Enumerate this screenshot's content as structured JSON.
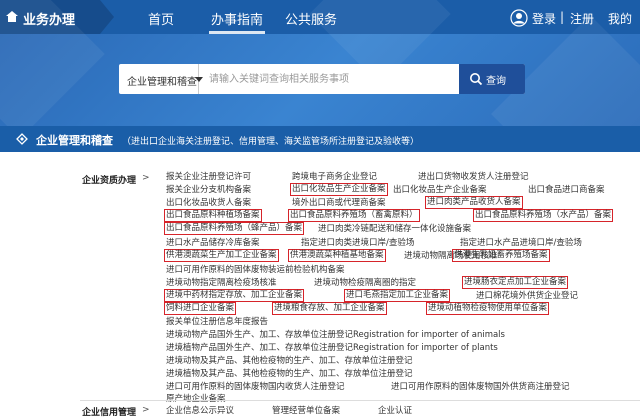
{
  "header": {
    "tab_label": "业务办理",
    "nav": [
      "首页",
      "办事指南",
      "公共服务"
    ],
    "login": "登录",
    "register": "注册",
    "my": "我的",
    "separator": "|"
  },
  "search": {
    "category": "企业管理和稽查",
    "placeholder": "请输入关键词查询相关服务事项",
    "button": "查询"
  },
  "section": {
    "title": "企业管理和稽查",
    "subtitle": "（进出口企业海关注册登记、信用管理、海关监管场所注册登记及验收等）"
  },
  "categories": [
    {
      "label": "企业资质办理",
      "arrow": ">"
    },
    {
      "label": "企业信用管理",
      "arrow": ">"
    }
  ],
  "items": [
    {
      "text": "报关企业注册登记许可"
    },
    {
      "text": "跨境电子商务企业登记"
    },
    {
      "text": "进出口货物收发货人注册登记"
    },
    {
      "text": "报关企业分支机构备案"
    },
    {
      "text": "出口化妆品生产企业备案"
    },
    {
      "text": "出口化妆品生产企业备案"
    },
    {
      "text": "出口食品进口商备案"
    },
    {
      "text": "出口化妆品收货人备案"
    },
    {
      "text": "境外出口商或代理商备案"
    },
    {
      "text": "进口肉类产品收货人备案"
    },
    {
      "text": "出口食品原料种植场备案"
    },
    {
      "text": "出口食品原料养殖场（畜禽原料）"
    },
    {
      "text": "出口食品原料养殖场（水产品）备案"
    },
    {
      "text": "出口食品原料养殖场（蜂产品）备案"
    },
    {
      "text": "进口肉类冷链配送和储存一体化设施备案"
    },
    {
      "text": "进口水产品储存冷库备案"
    },
    {
      "text": "指定进口肉类进境口岸/查验场"
    },
    {
      "text": "指定进口水产品进境口岸/查验场"
    },
    {
      "text": "供港澳蔬菜生产加工企业备案"
    },
    {
      "text": "供港澳蔬菜种植基地备案"
    },
    {
      "text": "进境动物隔离场使用核准"
    },
    {
      "text": "供港生乳奶畜养殖场备案"
    },
    {
      "text": "进口可用作原料的固体废物装运前检验机构备案"
    },
    {
      "text": "进境动物指定隔离检疫场核准"
    },
    {
      "text": "进境动物检疫隔离圈的指定"
    },
    {
      "text": "进境肠衣定点加工企业备案"
    },
    {
      "text": "进境中药材指定存放、加工企业备案"
    },
    {
      "text": "进口毛燕指定加工企业备案"
    },
    {
      "text": "进口棉花境外供货企业登记"
    },
    {
      "text": "饲料进口企业备案"
    },
    {
      "text": "进境粮食存放、加工企业备案"
    },
    {
      "text": "进境动植物检疫物使用单位备案"
    },
    {
      "text": "报关单位注册信息年度报告"
    },
    {
      "text": "进境动物产品国外生产、加工、存放单位注册登记Registration for importer of animals"
    },
    {
      "text": "进境植物产品国外生产、加工、存放单位注册登记Registration for importer of plants"
    },
    {
      "text": "进境动物及其产品、其他检疫物的生产、加工、存放单位注册登记"
    },
    {
      "text": "进境植物及其产品、其他检疫物的生产、加工、存放单位注册登记"
    },
    {
      "text": "进口可用作原料的固体废物国内收货人注册登记"
    },
    {
      "text": "进口可用作原料的固体废物国外供货商注册登记"
    },
    {
      "text": "原产地企业备案"
    },
    {
      "text": "企业信息公示异议"
    },
    {
      "text": "管理经营单位备案"
    },
    {
      "text": "企业认证"
    }
  ],
  "colors": {
    "header": "#1b5da8",
    "band": "#2f72c0",
    "section": "#1a5ea8",
    "highlight": "#d6242a"
  }
}
